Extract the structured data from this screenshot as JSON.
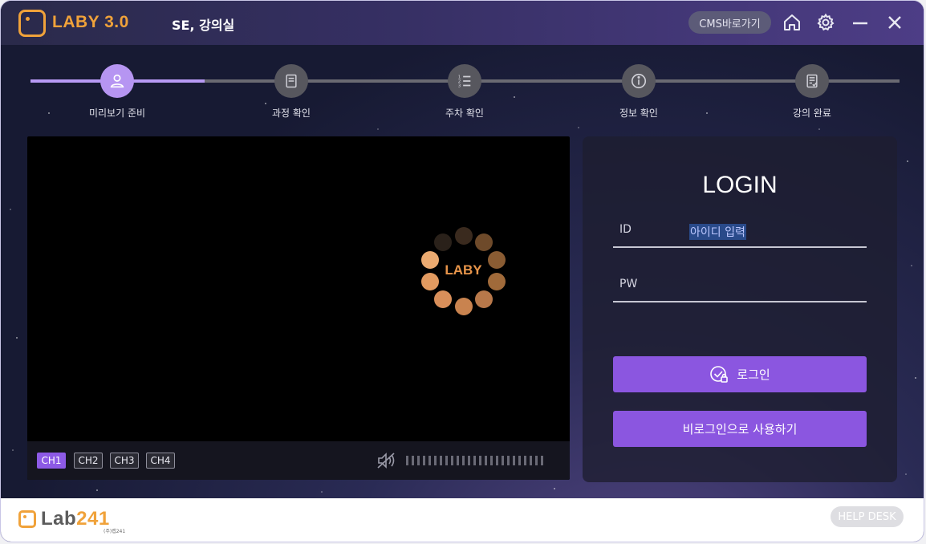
{
  "app": {
    "name": "LABY 3.0",
    "room_title": "SE, 강의실",
    "accent_color": "#f0a23a",
    "brand_purple": "#8b56e0"
  },
  "titlebar": {
    "cms_label": "CMS바로가기",
    "icons": [
      "home-icon",
      "settings-icon",
      "minimize-icon",
      "close-icon"
    ]
  },
  "steps": {
    "items": [
      {
        "label": "미리보기 준비",
        "icon": "user-icon",
        "active": true
      },
      {
        "label": "과정 확인",
        "icon": "book-icon",
        "active": false
      },
      {
        "label": "주차 확인",
        "icon": "list-icon",
        "active": false
      },
      {
        "label": "정보 확인",
        "icon": "info-icon",
        "active": false
      },
      {
        "label": "강의 완료",
        "icon": "document-check-icon",
        "active": false
      }
    ],
    "progress_fraction": 0.2
  },
  "video": {
    "loading_text": "LABY",
    "channels": [
      "CH1",
      "CH2",
      "CH3",
      "CH4"
    ],
    "active_channel": "CH1",
    "muted": true
  },
  "login": {
    "title": "LOGIN",
    "id_label": "ID",
    "id_placeholder": "아이디 입력",
    "pw_label": "PW",
    "pw_value": "",
    "login_button": "로그인",
    "guest_button": "비로그인으로 사용하기"
  },
  "footer": {
    "logo_text_dark": "Lab",
    "logo_text_accent": "241",
    "logo_sub": "(주)랩241",
    "help_label": "HELP DESK"
  }
}
